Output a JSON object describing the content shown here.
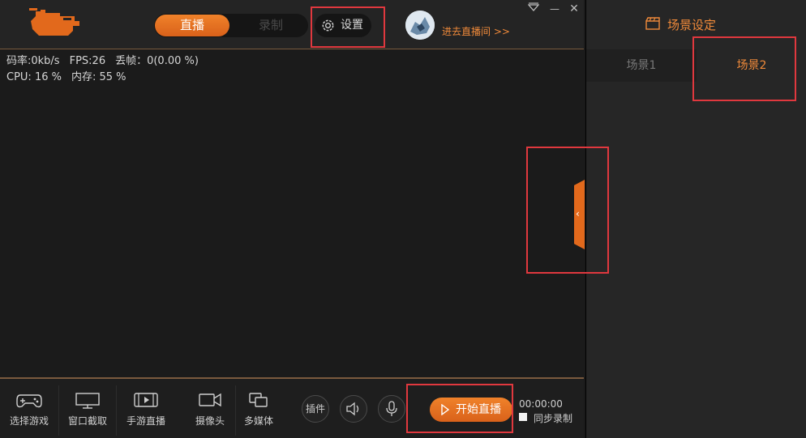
{
  "topbar": {
    "mode_live": "直播",
    "mode_record": "录制",
    "settings_label": "设置",
    "enter_room": "进去直播间 >>"
  },
  "stats": {
    "bitrate": "码率:0kb/s",
    "fps": "FPS:26",
    "dropped": "丢帧：0(0.00 %)",
    "cpu": "CPU: 16 %",
    "memory": "内存: 55 %"
  },
  "toolbar": {
    "select_game": "选择游戏",
    "window_capture": "窗口截取",
    "mobile_live": "手游直播",
    "camera": "摄像头",
    "multimedia": "多媒体",
    "plugin": "插件",
    "start_live": "开始直播",
    "timer": "00:00:00",
    "sync_record": "同步录制"
  },
  "side": {
    "title": "场景设定",
    "scene1": "场景1",
    "scene2": "场景2"
  },
  "colors": {
    "accent": "#e8701f",
    "highlight_box": "#e0383e"
  },
  "icons": {
    "window": [
      "dropdown-icon",
      "minimize-icon",
      "close-icon"
    ],
    "tools": [
      "gamepad-icon",
      "monitor-icon",
      "mobile-play-icon",
      "camera-icon",
      "multimedia-icon",
      "speaker-icon",
      "microphone-icon",
      "play-icon"
    ],
    "side": [
      "clapperboard-icon"
    ]
  }
}
